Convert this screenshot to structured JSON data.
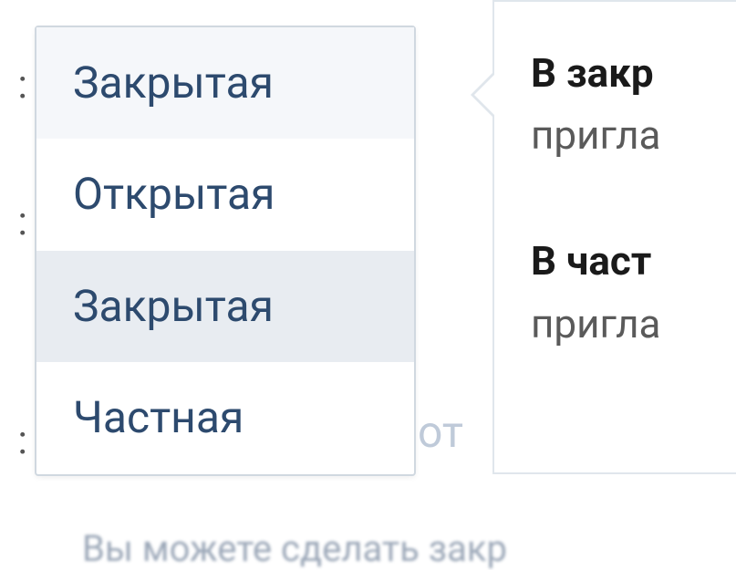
{
  "labels": {
    "row1_suffix": ":",
    "row2_suffix": ":",
    "row3_suffix": ":"
  },
  "dropdown": {
    "selected": "Закрытая",
    "options": [
      {
        "label": "Открытая"
      },
      {
        "label": "Закрытая"
      },
      {
        "label": "Частная"
      }
    ]
  },
  "tooltip": {
    "block1_strong": "В закр",
    "block1_rest": "пригла",
    "block2_strong": "В част",
    "block2_rest": "пригла"
  },
  "bg_text": "от",
  "hint_text": "Вы можете сделать закр"
}
